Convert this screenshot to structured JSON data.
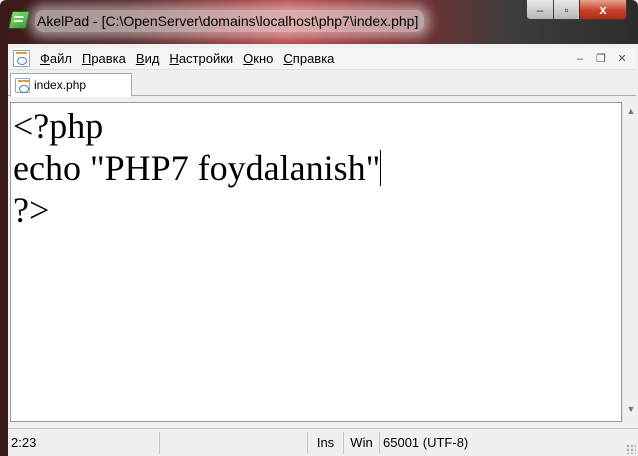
{
  "window": {
    "title": "AkelPad - [C:\\OpenServer\\domains\\localhost\\php7\\index.php]",
    "controls": {
      "minimize": "–",
      "maximize": "▫",
      "close": "x"
    }
  },
  "menubar": {
    "items": [
      {
        "label": "Файл"
      },
      {
        "label": "Правка"
      },
      {
        "label": "Вид"
      },
      {
        "label": "Настройки"
      },
      {
        "label": "Окно"
      },
      {
        "label": "Справка"
      }
    ],
    "mdi_controls": {
      "minimize": "–",
      "restore": "❐",
      "close": "✕"
    }
  },
  "tabs": [
    {
      "label": "index.php",
      "active": true
    }
  ],
  "editor": {
    "lines": [
      "<?php",
      "echo \"PHP7 foydalanish\"",
      "?>"
    ]
  },
  "statusbar": {
    "position": "2:23",
    "blank": "",
    "insert_mode": "Ins",
    "newline": "Win",
    "encoding": "65001 (UTF-8)"
  },
  "icons": {
    "app": "akelpad-icon",
    "document": "php-document-icon",
    "scroll_up": "▲",
    "scroll_down": "▼"
  },
  "colors": {
    "title_glass": "#b8474a",
    "close_button": "#c7422b",
    "editor_bg": "#ffffff"
  }
}
